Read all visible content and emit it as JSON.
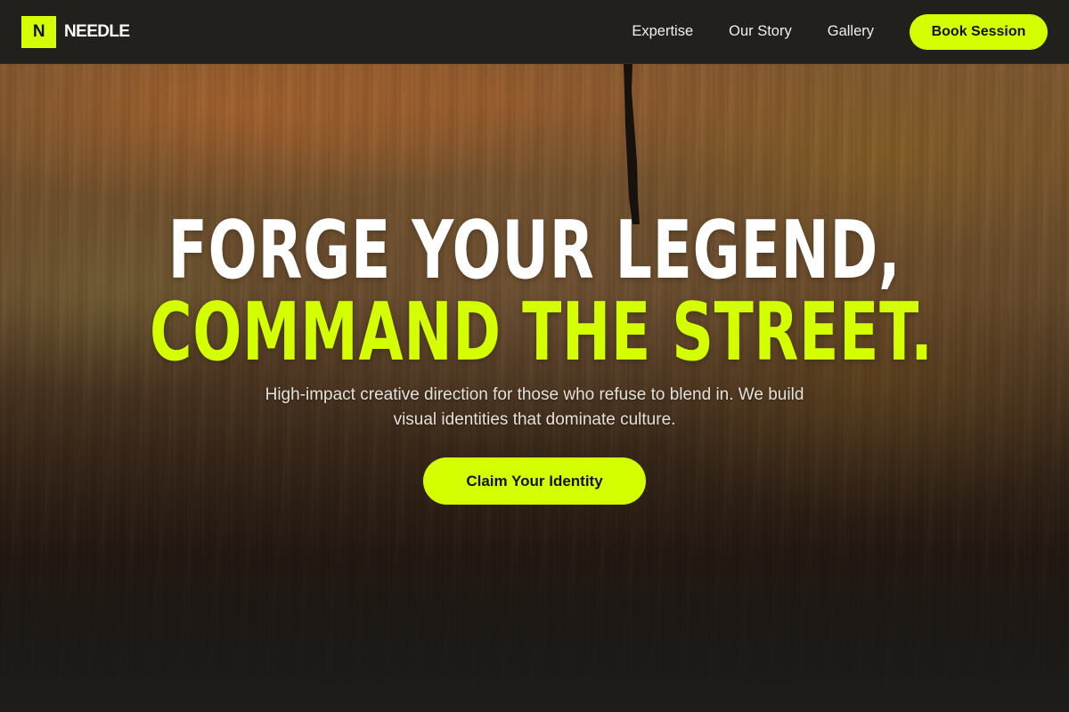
{
  "colors": {
    "accent": "#d4ff00",
    "navbar_bg": "#22201d",
    "page_bg": "#1e1d1b"
  },
  "brand": {
    "mark": "N",
    "name": "NEEDLE"
  },
  "nav": {
    "links": [
      "Expertise",
      "Our Story",
      "Gallery"
    ],
    "cta_label": "Book Session"
  },
  "hero": {
    "headline_line1": "FORGE YOUR LEGEND,",
    "headline_line2": "COMMAND THE STREET.",
    "subtitle": "High-impact creative direction for those who refuse to blend in. We build visual identities that dominate culture.",
    "cta_label": "Claim Your Identity",
    "background_image": "painted-wall-texture"
  }
}
